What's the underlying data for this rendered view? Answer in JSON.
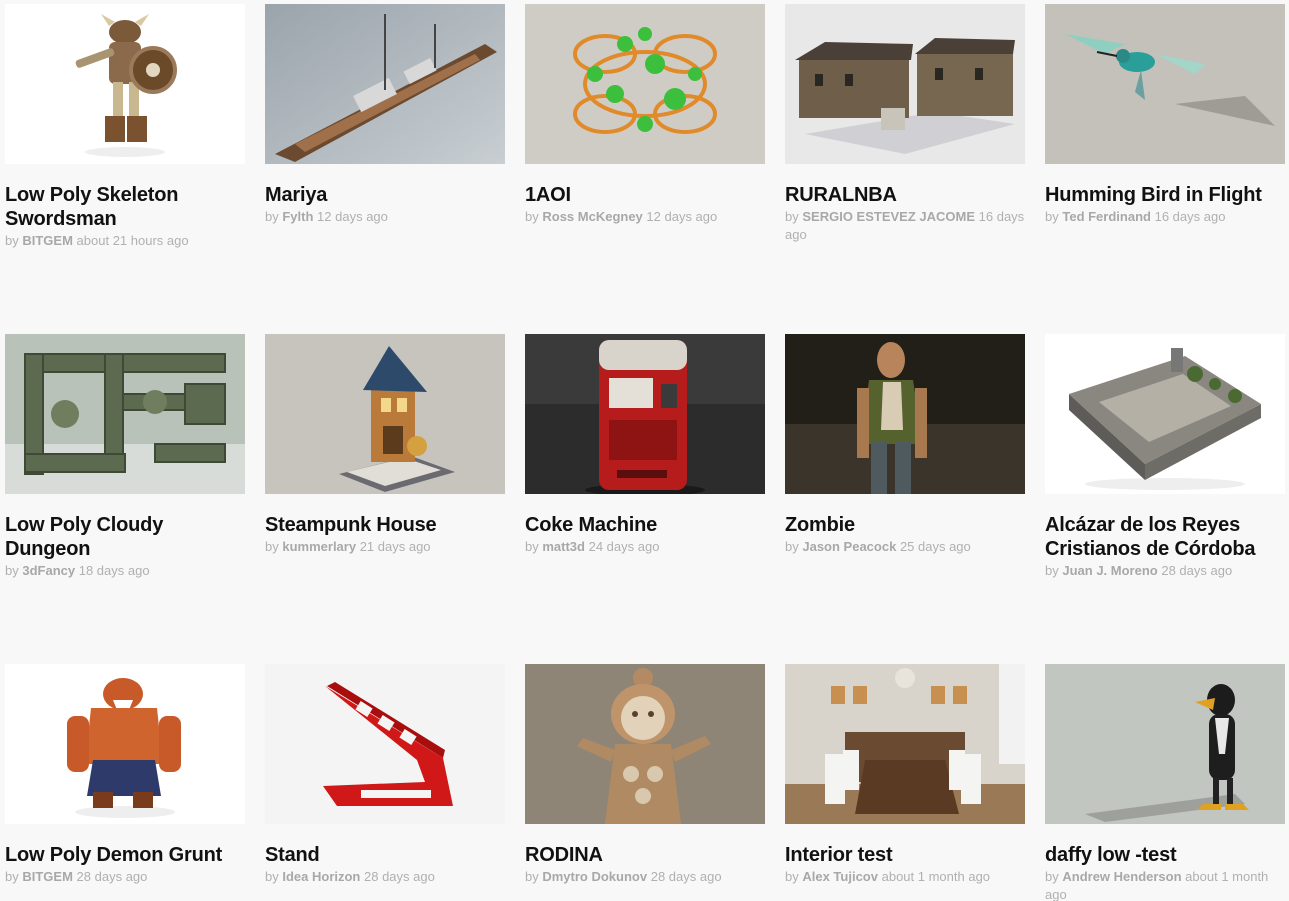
{
  "models": [
    {
      "title": "Low Poly Skeleton Swordsman",
      "by": "by",
      "author": "BITGEM",
      "time": "about 21 hours ago",
      "icon": "skeleton-warrior-thumbnail"
    },
    {
      "title": "Mariya",
      "by": "by",
      "author": "Fylth",
      "time": "12 days ago",
      "icon": "battleship-thumbnail"
    },
    {
      "title": "1AOI",
      "by": "by",
      "author": "Ross McKegney",
      "time": "12 days ago",
      "icon": "molecule-thumbnail"
    },
    {
      "title": "RURALNBA",
      "by": "by",
      "author": "SERGIO ESTEVEZ JACOME",
      "time": "16 days ago",
      "icon": "stone-house-thumbnail"
    },
    {
      "title": "Humming Bird in Flight",
      "by": "by",
      "author": "Ted Ferdinand",
      "time": "16 days ago",
      "icon": "hummingbird-thumbnail"
    },
    {
      "title": "Low Poly Cloudy Dungeon",
      "by": "by",
      "author": "3dFancy",
      "time": "18 days ago",
      "icon": "dungeon-thumbnail"
    },
    {
      "title": "Steampunk House",
      "by": "by",
      "author": "kummerlary",
      "time": "21 days ago",
      "icon": "steampunk-house-thumbnail"
    },
    {
      "title": "Coke Machine",
      "by": "by",
      "author": "matt3d",
      "time": "24 days ago",
      "icon": "vending-machine-thumbnail"
    },
    {
      "title": "Zombie",
      "by": "by",
      "author": "Jason Peacock",
      "time": "25 days ago",
      "icon": "zombie-thumbnail"
    },
    {
      "title": "Alcázar de los Reyes Cristianos de Córdoba",
      "by": "by",
      "author": "Juan J. Moreno",
      "time": "28 days ago",
      "icon": "castle-thumbnail"
    },
    {
      "title": "Low Poly Demon Grunt",
      "by": "by",
      "author": "BITGEM",
      "time": "28 days ago",
      "icon": "demon-thumbnail"
    },
    {
      "title": "Stand",
      "by": "by",
      "author": "Idea Horizon",
      "time": "28 days ago",
      "icon": "red-stand-thumbnail"
    },
    {
      "title": "RODINA",
      "by": "by",
      "author": "Dmytro Dokunov",
      "time": "28 days ago",
      "icon": "clay-figure-thumbnail"
    },
    {
      "title": "Interior test",
      "by": "by",
      "author": "Alex Tujicov",
      "time": "about 1 month ago",
      "icon": "dining-room-thumbnail"
    },
    {
      "title": "daffy low -test",
      "by": "by",
      "author": "Andrew Henderson",
      "time": "about 1 month ago",
      "icon": "duck-thumbnail"
    }
  ]
}
